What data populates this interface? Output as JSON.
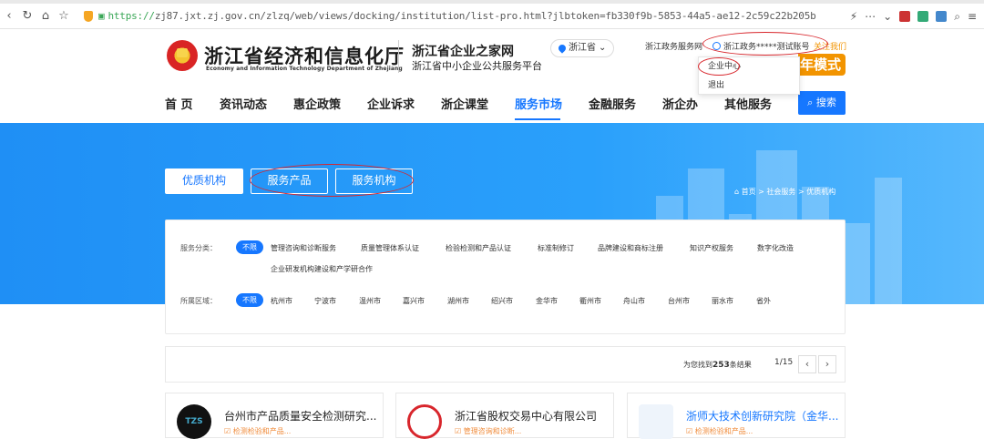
{
  "browser": {
    "url": "https://zj87.jxt.zj.gov.cn/zlzq/web/views/docking/institution/list-pro.html?jlbtoken=fb330f9b-5853-44a5-ae12-2c59c22b205b",
    "url_proto": "https://",
    "url_rest": "zj87.jxt.zj.gov.cn/zlzq/web/views/docking/institution/list-pro.html?jlbtoken=fb330f9b-5853-44a5-ae12-2c59c22b205b"
  },
  "header": {
    "org_name_cn": "浙江省经济和信息化厅",
    "org_name_en": "Economy and Information Technology Department of Zhejiang",
    "platform_title": "浙江省企业之家网",
    "platform_subtitle": "浙江省中小企业公共服务平台",
    "region": "浙江省",
    "gov_service_link": "浙江政务服务网",
    "user_account": "浙江政务*****测试账号",
    "contact_link": "关注我们",
    "elder_mode": "年模式",
    "dropdown": [
      "企业中心",
      "退出"
    ]
  },
  "nav": {
    "items": [
      "首 页",
      "资讯动态",
      "惠企政策",
      "企业诉求",
      "浙企课堂",
      "服务市场",
      "金融服务",
      "浙企办",
      "其他服务"
    ],
    "active": "服务市场",
    "search_label": "搜索"
  },
  "banner": {
    "tabs": [
      "优质机构",
      "服务产品",
      "服务机构"
    ],
    "active_tab": "优质机构",
    "breadcrumb": "首页 > 社会服务 > 优质机构"
  },
  "filters": {
    "category_label": "服务分类：",
    "categories": [
      "不限",
      "管理咨询和诊断服务",
      "质量管理体系认证",
      "检验检测和产品认证",
      "标准制修订",
      "品牌建设和商标注册",
      "知识产权服务",
      "数字化改造",
      "企业研发机构建设和产学研合作"
    ],
    "region_label": "所属区域：",
    "regions": [
      "不限",
      "杭州市",
      "宁波市",
      "温州市",
      "嘉兴市",
      "湖州市",
      "绍兴市",
      "金华市",
      "衢州市",
      "舟山市",
      "台州市",
      "丽水市",
      "省外"
    ]
  },
  "results": {
    "prefix": "为您找到",
    "count": "253",
    "suffix": "条结果",
    "page": "1/15",
    "prev": "‹",
    "next": "›"
  },
  "cards": [
    {
      "title": "台州市产品质量安全检测研究...",
      "sub": "☑ 检测检验和产品..."
    },
    {
      "title": "浙江省股权交易中心有限公司",
      "sub": "☑ 管理咨询和诊断..."
    },
    {
      "title": "浙师大技术创新研究院（金华...",
      "sub": "☑ 检测检验和产品..."
    }
  ],
  "colors": {
    "primary": "#1677ff",
    "accent": "#f29400",
    "annotation": "#d8262c"
  }
}
